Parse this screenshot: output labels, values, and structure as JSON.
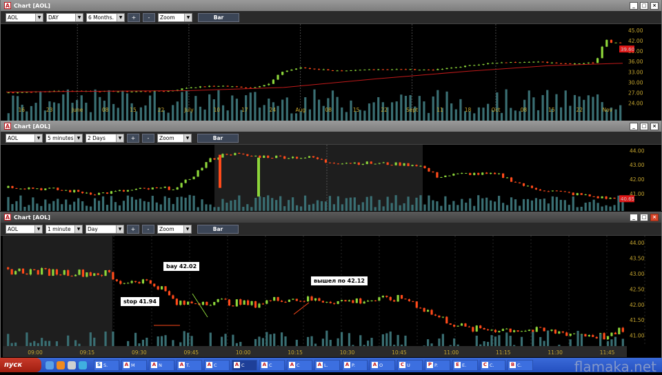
{
  "windows": [
    {
      "title": "Chart [AOL]",
      "symbol": "AOL",
      "interval": "DAY",
      "range": "6 Months.",
      "zoom": "Zoom",
      "plus": "+",
      "minus": "-",
      "bar_label": "Bar",
      "price_ticks": [
        "45.00",
        "42.00",
        "39.00",
        "36.00",
        "33.00",
        "30.00",
        "27.00",
        "24.00"
      ],
      "price_tag": "39.60",
      "time_ticks": [
        "16",
        "23",
        "June",
        "08",
        "15",
        "22",
        "July",
        "10",
        "17",
        "24",
        "Aug",
        "08",
        "15",
        "22",
        "Sept",
        "11",
        "18",
        "Oct",
        "08",
        "15",
        "22",
        "Nov"
      ]
    },
    {
      "title": "Chart [AOL]",
      "symbol": "AOL",
      "interval": "5 minutes",
      "range": "2 Days",
      "zoom": "Zoom",
      "plus": "+",
      "minus": "-",
      "bar_label": "Bar",
      "price_ticks": [
        "44.00",
        "43.00",
        "42.00",
        "41.00"
      ],
      "price_tag": "40.65",
      "time_ticks": []
    },
    {
      "title": "Chart [AOL]",
      "symbol": "AOL",
      "interval": "1 minute",
      "range": "Day",
      "zoom": "Zoom",
      "plus": "+",
      "minus": "-",
      "bar_label": "Bar",
      "price_ticks": [
        "44.00",
        "43.50",
        "43.00",
        "42.50",
        "42.00",
        "41.50",
        "41.00"
      ],
      "price_tag": "",
      "time_ticks": [
        "09:00",
        "09:15",
        "09:30",
        "09:45",
        "10:00",
        "10:15",
        "10:30",
        "10:45",
        "11:00",
        "11:15",
        "11:30",
        "11:45"
      ],
      "annotations": {
        "buy": "bay 42.02",
        "sell": "вышел по 42.12",
        "stop": "stop 41.94"
      }
    }
  ],
  "taskbar": {
    "start": "пуск",
    "tasks": [
      {
        "letter": "A",
        "label": "M"
      },
      {
        "letter": "A",
        "label": "N"
      },
      {
        "letter": "A",
        "label": "T."
      },
      {
        "letter": "A",
        "label": "C"
      },
      {
        "letter": "A",
        "label": "C"
      },
      {
        "letter": "A",
        "label": "C"
      },
      {
        "letter": "A",
        "label": "C"
      },
      {
        "letter": "A",
        "label": "L."
      },
      {
        "letter": "A",
        "label": "P."
      },
      {
        "letter": "A",
        "label": "O"
      },
      {
        "letter": "C",
        "label": "U"
      },
      {
        "letter": "P",
        "label": "P."
      },
      {
        "letter": "E",
        "label": "E."
      },
      {
        "letter": "C",
        "label": "C."
      },
      {
        "letter": "B",
        "label": "C."
      }
    ],
    "first_task": "S."
  },
  "watermark": "flamaka.net",
  "colors": {
    "up": "#8dd63a",
    "down": "#ff4a1a",
    "volume": "#3a6f73",
    "ma": "#c21a1a",
    "axis": "#c8a830"
  }
}
